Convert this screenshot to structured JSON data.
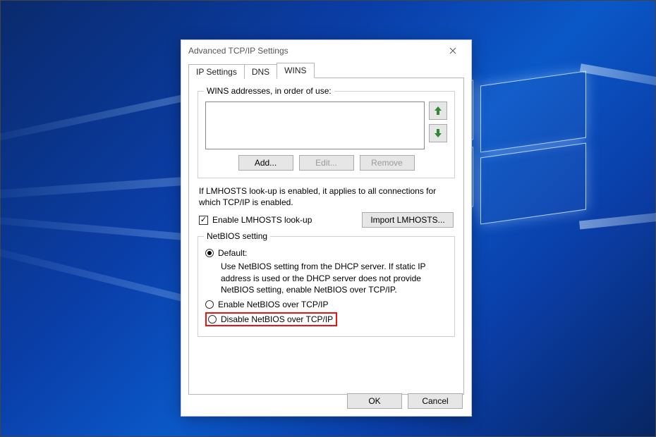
{
  "window": {
    "title": "Advanced TCP/IP Settings",
    "close_tooltip": "Close"
  },
  "tabs": {
    "ip_settings": "IP Settings",
    "dns": "DNS",
    "wins": "WINS",
    "active": "wins"
  },
  "wins": {
    "addresses_label": "WINS addresses, in order of use:",
    "move_up_tooltip": "Move up",
    "move_down_tooltip": "Move down",
    "add": "Add...",
    "edit": "Edit...",
    "remove": "Remove",
    "lmhosts_note": "If LMHOSTS look-up is enabled, it applies to all connections for which TCP/IP is enabled.",
    "enable_lmhosts": "Enable LMHOSTS look-up",
    "enable_lmhosts_checked": true,
    "import_lmhosts": "Import LMHOSTS...",
    "netbios_group": "NetBIOS setting",
    "default_label": "Default:",
    "default_desc": "Use NetBIOS setting from the DHCP server. If static IP address is used or the DHCP server does not provide NetBIOS setting, enable NetBIOS over TCP/IP.",
    "enable_netbios": "Enable NetBIOS over TCP/IP",
    "disable_netbios": "Disable NetBIOS over TCP/IP",
    "netbios_selected": "default"
  },
  "footer": {
    "ok": "OK",
    "cancel": "Cancel"
  }
}
